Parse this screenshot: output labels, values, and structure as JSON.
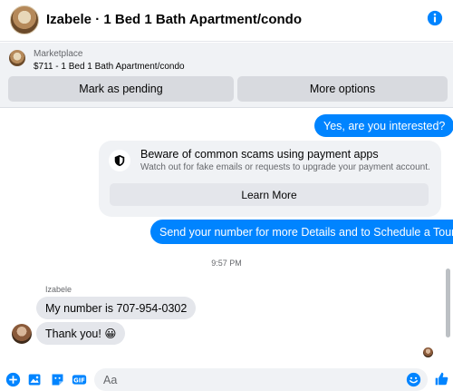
{
  "header": {
    "title": "Izabele · 1 Bed 1 Bath Apartment/condo"
  },
  "marketplace": {
    "label": "Marketplace",
    "item": "$711 - 1 Bed 1 Bath Apartment/condo",
    "pending_button": "Mark as pending",
    "more_button": "More options"
  },
  "messages": {
    "out_1": "Yes, are you interested?",
    "warning_title": "Beware of common scams using payment apps",
    "warning_text": "Watch out for fake emails or requests to upgrade your payment account.",
    "learn_more": "Learn More",
    "out_2": "Send your number for more Details and to Schedule a Tour.",
    "timestamp": "9:57 PM",
    "sender_name": "Izabele",
    "in_1": "My number is 707-954-0302",
    "in_2": "Thank you! 😀"
  },
  "composer": {
    "placeholder": "Aa"
  },
  "colors": {
    "accent": "#0084ff",
    "bubble_in": "#e4e6eb",
    "panel": "#f0f2f5"
  },
  "icons": [
    "info-icon",
    "shield-icon",
    "plus-icon",
    "image-icon",
    "sticker-icon",
    "gif-icon",
    "emoji-icon",
    "like-icon"
  ]
}
